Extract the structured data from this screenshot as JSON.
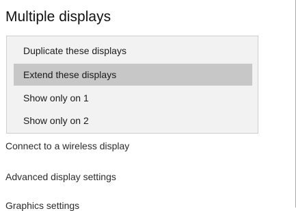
{
  "section": {
    "title": "Multiple displays"
  },
  "dropdown": {
    "options": [
      {
        "label": "Duplicate these displays",
        "selected": false
      },
      {
        "label": "Extend these displays",
        "selected": true
      },
      {
        "label": "Show only on 1",
        "selected": false
      },
      {
        "label": "Show only on 2",
        "selected": false
      }
    ],
    "highlight_color": "#c7c7c7",
    "background_color": "#f2f2f2"
  },
  "links": {
    "wireless": "Connect to a wireless display",
    "advanced": "Advanced display settings",
    "graphics": "Graphics settings"
  }
}
